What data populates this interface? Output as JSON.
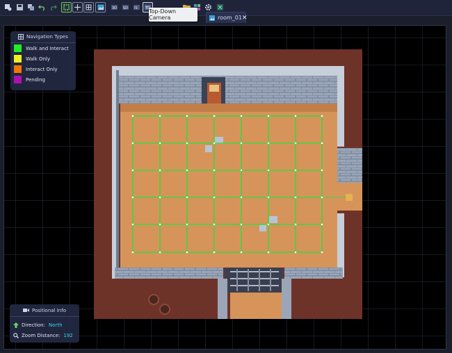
{
  "toolbar": {
    "buttons": [
      "scene-icon",
      "save-icon",
      "duplicate-icon",
      "undo-icon",
      "redo-icon",
      "select-tool-icon",
      "move-tool-icon",
      "grid-snap-icon",
      "image-icon",
      "camera-front-icon",
      "camera-side-icon",
      "camera-top-down-icon",
      "camera-iso-icon",
      "folder-icon",
      "palette-icon",
      "settings-icon",
      "close-square-icon"
    ],
    "tooltip": "Top-Down Camera"
  },
  "tab": {
    "label": "room_01",
    "close": "✕"
  },
  "legend": {
    "title": "Navigation Types",
    "items": [
      {
        "label": "Walk and Interact",
        "color": "#22ee22"
      },
      {
        "label": "Walk Only",
        "color": "#f0f020"
      },
      {
        "label": "Interact Only",
        "color": "#f07800"
      },
      {
        "label": "Pending",
        "color": "#b010b0"
      }
    ]
  },
  "position": {
    "title": "Positional Info",
    "direction_label": "Direction:",
    "direction_value": "North",
    "zoom_label": "Zoom Distance:",
    "zoom_value": "192"
  },
  "colors": {
    "grid_line": "#2f3145",
    "nav_grid": "#3ed63e",
    "floor": "#d6945a",
    "wall_stone": "#9aa6b8",
    "dirt": "#6e3328",
    "value_cyan": "#38d7f0"
  },
  "scene": {
    "nav_grid_columns": 7,
    "nav_grid_rows": 5
  }
}
